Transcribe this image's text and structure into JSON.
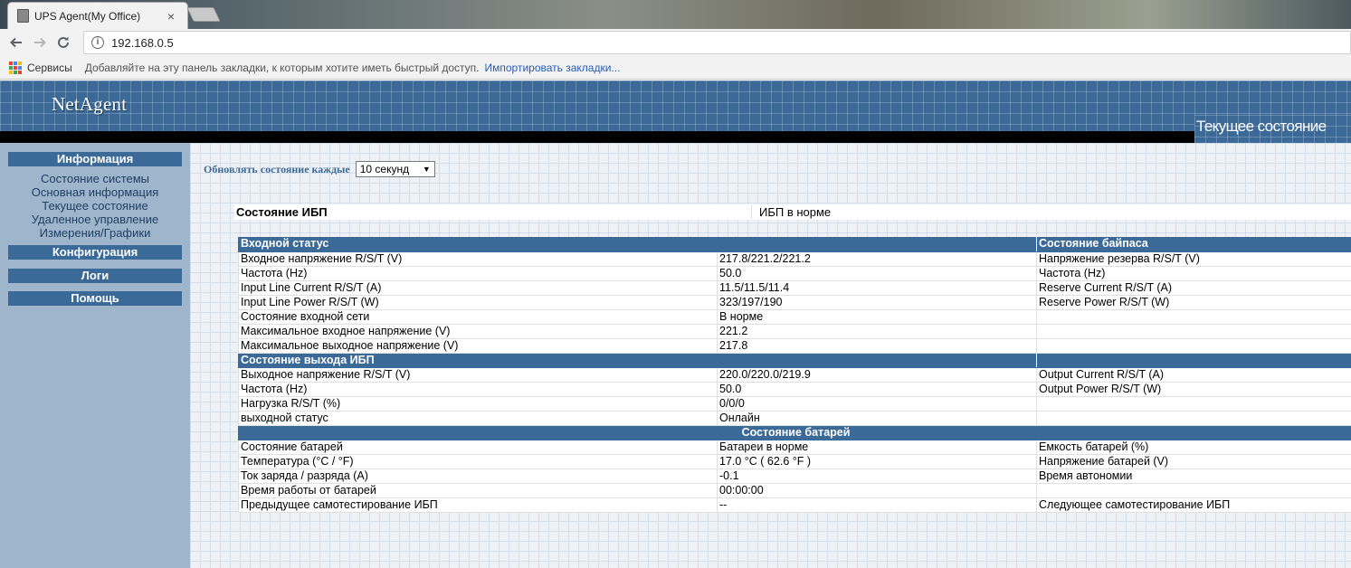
{
  "browser": {
    "tab_title": "UPS Agent(My Office)",
    "tab_close": "×",
    "url": "192.168.0.5",
    "bookmarks_apps": "Сервисы",
    "bookmarks_hint": "Добавляйте на эту панель закладки, к которым хотите иметь быстрый доступ.",
    "bookmarks_import": "Импортировать закладки..."
  },
  "header": {
    "logo": "NetAgent",
    "page_title": "Текущее состояние"
  },
  "sidebar": {
    "info_title": "Информация",
    "info_links": [
      "Состояние системы",
      "Основная информация",
      "Текущее состояние",
      "Удаленное управление",
      "Измерения/Графики"
    ],
    "config_title": "Конфигурация",
    "logs_title": "Логи",
    "help_title": "Помощь"
  },
  "refresh": {
    "label": "Обновлять состояние каждые",
    "value": "10 секунд"
  },
  "ups_status": {
    "label": "Состояние ИБП",
    "value": "ИБП в норме"
  },
  "input": {
    "title": "Входной статус",
    "bypass_title": "Состояние байпаса",
    "rows": [
      {
        "label": "Входное напряжение R/S/T (V)",
        "value": "217.8/221.2/221.2",
        "bypass": "Напряжение резерва R/S/T (V)"
      },
      {
        "label": "Частота (Hz)",
        "value": "50.0",
        "bypass": "Частота (Hz)"
      },
      {
        "label": "Input Line Current R/S/T (A)",
        "value": "11.5/11.5/11.4",
        "bypass": "Reserve Current R/S/T (A)"
      },
      {
        "label": "Input Line Power R/S/T (W)",
        "value": "323/197/190",
        "bypass": "Reserve Power R/S/T (W)"
      },
      {
        "label": "Состояние входной сети",
        "value": "В норме",
        "bypass": ""
      },
      {
        "label": "Максимальное входное напряжение (V)",
        "value": "221.2",
        "bypass": ""
      },
      {
        "label": "Максимальное выходное напряжение (V)",
        "value": "217.8",
        "bypass": ""
      }
    ]
  },
  "output": {
    "title": "Состояние выхода ИБП",
    "rows": [
      {
        "label": "Выходное напряжение R/S/T (V)",
        "value": "220.0/220.0/219.9",
        "extra": "Output Current R/S/T (A)"
      },
      {
        "label": "Частота (Hz)",
        "value": "50.0",
        "extra": "Output Power R/S/T (W)"
      },
      {
        "label": "Нагрузка R/S/T (%)",
        "value": "0/0/0",
        "extra": ""
      },
      {
        "label": "выходной статус",
        "value": "Онлайн",
        "extra": ""
      }
    ]
  },
  "battery": {
    "title": "Состояние батарей",
    "rows": [
      {
        "label": "Состояние батарей",
        "value": "Батареи в норме",
        "extra": "Емкость батарей (%)"
      },
      {
        "label": "Температура (°C / °F)",
        "value": "17.0 °C ( 62.6 °F )",
        "extra": "Напряжение батарей (V)"
      },
      {
        "label": "Ток заряда / разряда (A)",
        "value": "-0.1",
        "extra": "Время автономии"
      },
      {
        "label": "Время работы от батарей",
        "value": "00:00:00",
        "extra": ""
      },
      {
        "label": "Предыдущее самотестирование ИБП",
        "value": "--",
        "extra": "Следующее самотестирование ИБП"
      }
    ]
  }
}
